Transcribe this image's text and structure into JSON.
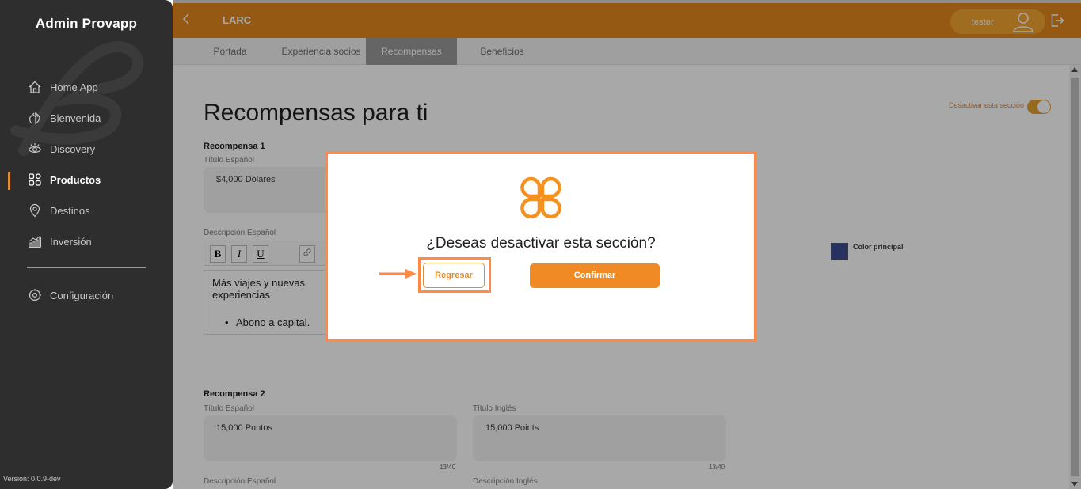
{
  "sidebar": {
    "brand": "Admin Provapp",
    "items": [
      {
        "label": "Home App",
        "icon": "home-icon"
      },
      {
        "label": "Bienvenida",
        "icon": "wave-hand-icon"
      },
      {
        "label": "Discovery",
        "icon": "eye-icon"
      },
      {
        "label": "Productos",
        "icon": "grid-icon",
        "active": true
      },
      {
        "label": "Destinos",
        "icon": "location-pin-icon"
      },
      {
        "label": "Inversión",
        "icon": "chart-bars-icon"
      }
    ],
    "settings": {
      "label": "Configuración",
      "icon": "gear-icon"
    },
    "version": "Versión: 0.0.9-dev"
  },
  "header": {
    "title": "LARC",
    "user": "tester",
    "back_icon": "chevron-left-icon",
    "logout_icon": "logout-icon"
  },
  "tabs": [
    {
      "label": "Portada"
    },
    {
      "label": "Experiencia socios"
    },
    {
      "label": "Recompensas",
      "active": true
    },
    {
      "label": "Beneficios"
    }
  ],
  "main": {
    "page_title": "Recompensas para ti",
    "toggle_label": "Desactivar esta sección",
    "toggle_on": true,
    "reward1": {
      "heading": "Recompensa 1",
      "title_es_label": "Título Español",
      "title_es_value": "$4,000 Dólares",
      "desc_es_label": "Descripción Español",
      "toolbar": {
        "bold": "B",
        "italic": "I",
        "underline": "U"
      },
      "desc_line": "Más viajes y nuevas experiencias",
      "desc_bullet": "Abono a capital."
    },
    "color": {
      "label": "Color principal",
      "value": "#3e4d93"
    },
    "reward2": {
      "heading": "Recompensa 2",
      "title_es_label": "Título Español",
      "title_es_value": "15,000 Puntos",
      "title_es_count": "13/40",
      "title_en_label": "Título Inglés",
      "title_en_value": "15,000 Points",
      "title_en_count": "13/40",
      "desc_es_label": "Descripción Español",
      "desc_en_label": "Descripción Inglés"
    }
  },
  "modal": {
    "question": "¿Deseas desactivar esta sección?",
    "back_label": "Regresar",
    "confirm_label": "Confirmar",
    "logo_icon": "clover-logo-icon",
    "accent": "#f08a24",
    "highlight": "#ff8a47"
  },
  "colors": {
    "primary": "#e4871f",
    "sidebar_bg": "#2e2e2e"
  }
}
